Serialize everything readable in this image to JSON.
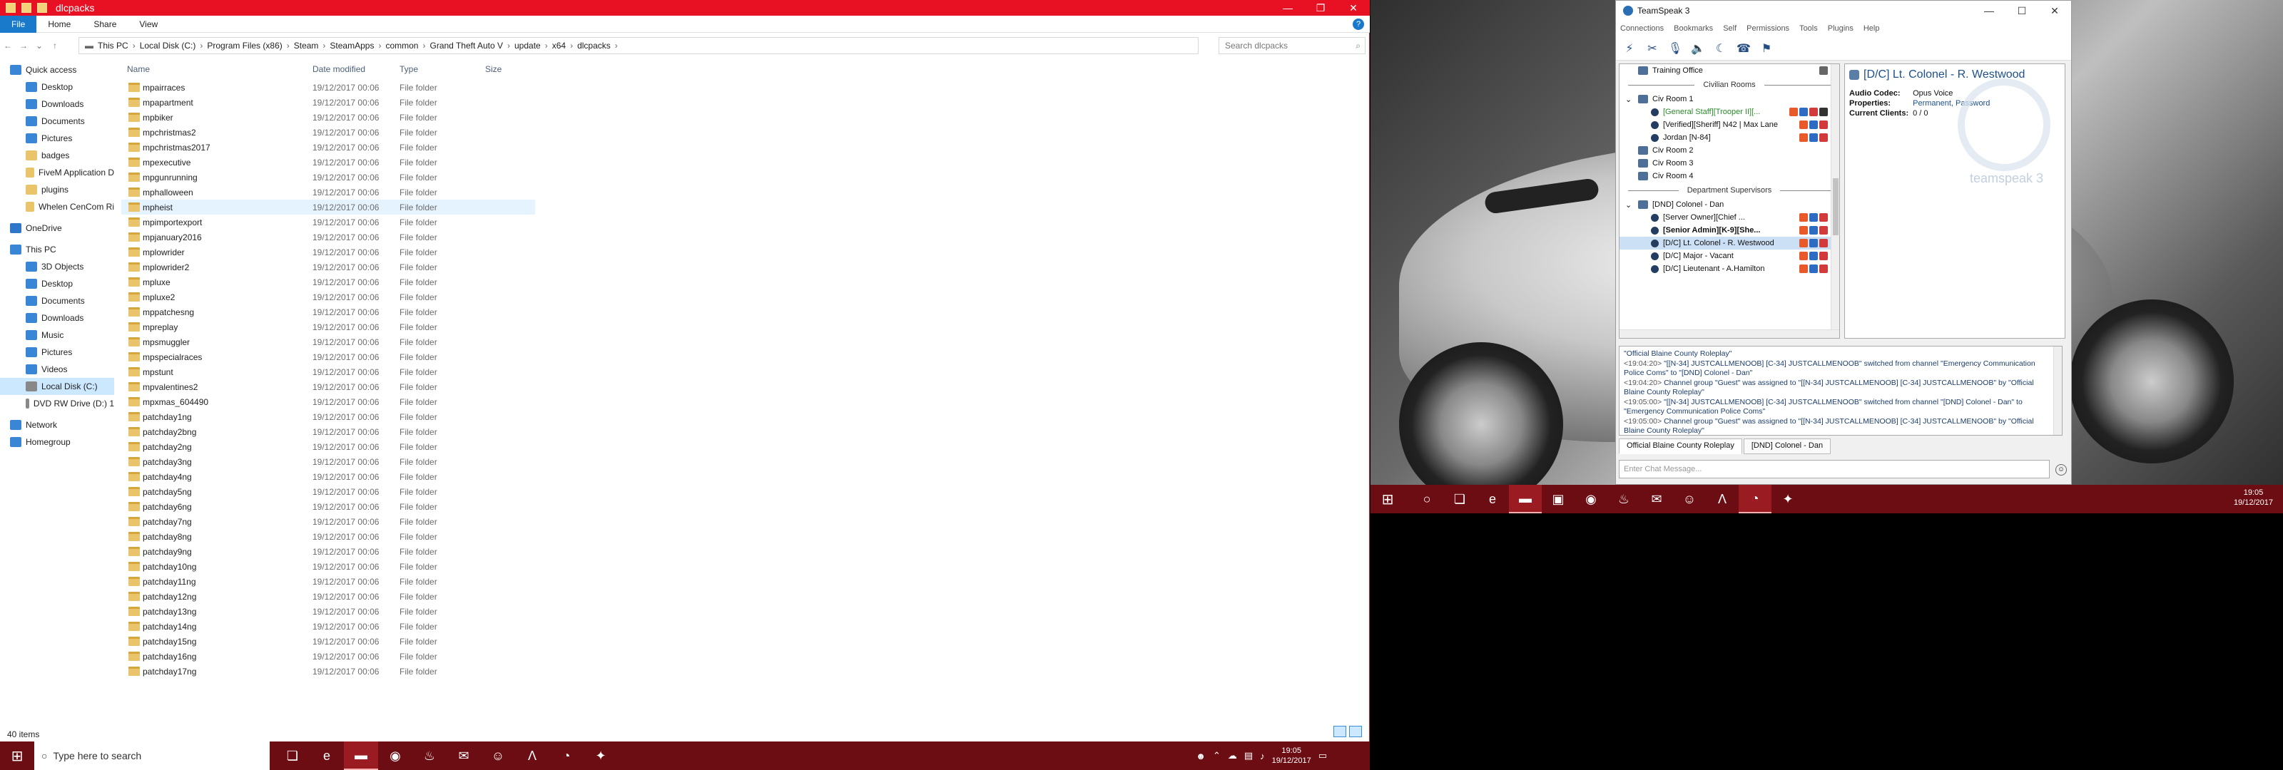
{
  "explorer": {
    "title": "dlcpacks",
    "ribbon_tabs": [
      "File",
      "Home",
      "Share",
      "View"
    ],
    "help": "?",
    "breadcrumb": [
      "This PC",
      "Local Disk (C:)",
      "Program Files (x86)",
      "Steam",
      "SteamApps",
      "common",
      "Grand Theft Auto V",
      "update",
      "x64",
      "dlcpacks"
    ],
    "search_placeholder": "Search dlcpacks",
    "nav": [
      {
        "label": "Quick access",
        "kind": "star"
      },
      {
        "label": "Desktop",
        "kind": "blue"
      },
      {
        "label": "Downloads",
        "kind": "blue"
      },
      {
        "label": "Documents",
        "kind": "blue"
      },
      {
        "label": "Pictures",
        "kind": "blue"
      },
      {
        "label": "badges",
        "kind": "folder"
      },
      {
        "label": "FiveM Application D",
        "kind": "folder"
      },
      {
        "label": "plugins",
        "kind": "folder"
      },
      {
        "label": "Whelen CenCom Ri",
        "kind": "folder"
      },
      {
        "label": "OneDrive",
        "kind": "cloud"
      },
      {
        "label": "This PC",
        "kind": "pc"
      },
      {
        "label": "3D Objects",
        "kind": "blue"
      },
      {
        "label": "Desktop",
        "kind": "blue"
      },
      {
        "label": "Documents",
        "kind": "blue"
      },
      {
        "label": "Downloads",
        "kind": "blue"
      },
      {
        "label": "Music",
        "kind": "blue"
      },
      {
        "label": "Pictures",
        "kind": "blue"
      },
      {
        "label": "Videos",
        "kind": "blue"
      },
      {
        "label": "Local Disk (C:)",
        "kind": "drive"
      },
      {
        "label": "DVD RW Drive (D:) 1",
        "kind": "drive"
      },
      {
        "label": "Network",
        "kind": "pc"
      },
      {
        "label": "Homegroup",
        "kind": "pc"
      }
    ],
    "columns": {
      "name": "Name",
      "date": "Date modified",
      "type": "Type",
      "size": "Size"
    },
    "file_date": "19/12/2017 00:06",
    "file_type": "File folder",
    "files": [
      "mpairraces",
      "mpapartment",
      "mpbiker",
      "mpchristmas2",
      "mpchristmas2017",
      "mpexecutive",
      "mpgunrunning",
      "mphalloween",
      "mpheist",
      "mpimportexport",
      "mpjanuary2016",
      "mplowrider",
      "mplowrider2",
      "mpluxe",
      "mpluxe2",
      "mppatchesng",
      "mpreplay",
      "mpsmuggler",
      "mpspecialraces",
      "mpstunt",
      "mpvalentines2",
      "mpxmas_604490",
      "patchday1ng",
      "patchday2bng",
      "patchday2ng",
      "patchday3ng",
      "patchday4ng",
      "patchday5ng",
      "patchday6ng",
      "patchday7ng",
      "patchday8ng",
      "patchday9ng",
      "patchday10ng",
      "patchday11ng",
      "patchday12ng",
      "patchday13ng",
      "patchday14ng",
      "patchday15ng",
      "patchday16ng",
      "patchday17ng"
    ],
    "status": "40 items"
  },
  "taskbar": {
    "search_placeholder": "Type here to search",
    "time": "19:05",
    "date": "19/12/2017"
  },
  "teamspeak": {
    "title": "TeamSpeak 3",
    "menu": [
      "Connections",
      "Bookmarks",
      "Self",
      "Permissions",
      "Tools",
      "Plugins",
      "Help"
    ],
    "tree": [
      {
        "t": "channel",
        "label": "Training Office",
        "indent": 1
      },
      {
        "t": "sep",
        "label": "Civilian Rooms"
      },
      {
        "t": "channel",
        "label": "Civ Room 1",
        "indent": 1,
        "exp": true
      },
      {
        "t": "client",
        "label": "[General Staff][Trooper II][...",
        "indent": 2,
        "green": true
      },
      {
        "t": "client",
        "label": "[Verified][Sheriff] N42 | Max Lane",
        "indent": 2
      },
      {
        "t": "client",
        "label": "Jordan [N-84]",
        "indent": 2
      },
      {
        "t": "channel",
        "label": "Civ Room 2",
        "indent": 1
      },
      {
        "t": "channel",
        "label": "Civ Room 3",
        "indent": 1
      },
      {
        "t": "channel",
        "label": "Civ Room 4",
        "indent": 1
      },
      {
        "t": "sep",
        "label": "Department Supervisors"
      },
      {
        "t": "channel",
        "label": "[DND] Colonel - Dan",
        "indent": 1,
        "exp": true
      },
      {
        "t": "client",
        "label": "[Server Owner][Chief ...",
        "indent": 2
      },
      {
        "t": "client",
        "label": "[Senior Admin][K-9][She...",
        "indent": 2,
        "bold": true
      },
      {
        "t": "client",
        "label": "[D/C] Lt. Colonel - R. Westwood",
        "indent": 2,
        "sel": true
      },
      {
        "t": "client",
        "label": "[D/C] Major - Vacant",
        "indent": 2
      },
      {
        "t": "client",
        "label": "[D/C] Lieutenant - A.Hamilton",
        "indent": 2
      }
    ],
    "info": {
      "title": "[D/C] Lt. Colonel - R. Westwood",
      "codec_label": "Audio Codec:",
      "codec": "Opus Voice",
      "props_label": "Properties:",
      "props": "Permanent, Password",
      "clients_label": "Current Clients:",
      "clients": "0 / 0",
      "watermark": "teamspeak 3"
    },
    "chat": [
      {
        "time": "",
        "text": "\"Official Blaine County Roleplay\""
      },
      {
        "time": "<19:04:20>",
        "text": "\"[[N-34] JUSTCALLMENOOB] [C-34] JUSTCALLMENOOB\" switched from channel \"Emergency Communication Police Coms\" to \"[DND] Colonel - Dan\""
      },
      {
        "time": "<19:04:20>",
        "text": "Channel group \"Guest\" was assigned to \"[[N-34] JUSTCALLMENOOB] [C-34] JUSTCALLMENOOB\" by \"Official Blaine County Roleplay\""
      },
      {
        "time": "<19:05:00>",
        "text": "\"[[N-34] JUSTCALLMENOOB] [C-34] JUSTCALLMENOOB\" switched from channel \"[DND] Colonel - Dan\" to \"Emergency Communication Police Coms\""
      },
      {
        "time": "<19:05:00>",
        "text": "Channel group \"Guest\" was assigned to \"[[N-34] JUSTCALLMENOOB] [C-34] JUSTCALLMENOOB\" by \"Official Blaine County Roleplay\""
      }
    ],
    "tabs": [
      "Official Blaine County Roleplay",
      "[DND] Colonel - Dan"
    ],
    "chat_placeholder": "Enter Chat Message..."
  },
  "colors": {
    "titlebar": "#e81123",
    "taskbar": "#6b0d12",
    "accent": "#1979ca"
  }
}
